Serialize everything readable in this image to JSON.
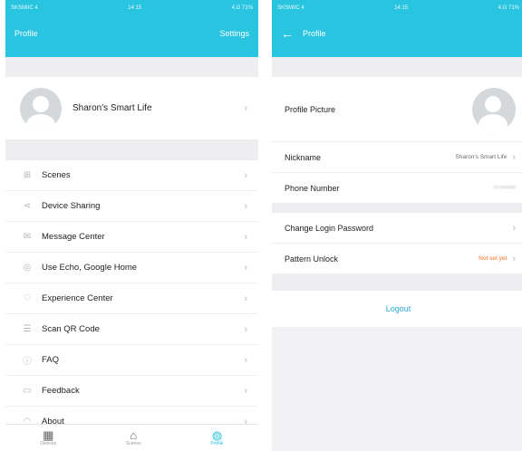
{
  "left": {
    "status": {
      "carrier": "SKSMIIC 4",
      "time": "14:15",
      "right": "4.G 71%"
    },
    "header": {
      "title": "Profile",
      "settings": "Settings"
    },
    "profile_name": "Sharon's Smart Life",
    "menu": [
      {
        "icon": "scenes-icon",
        "glyph": "⊞",
        "label": "Scenes"
      },
      {
        "icon": "share-icon",
        "glyph": "⋖",
        "label": "Device Sharing"
      },
      {
        "icon": "message-icon",
        "glyph": "✉",
        "label": "Message Center"
      },
      {
        "icon": "echo-icon",
        "glyph": "◎",
        "label": "Use Echo, Google Home"
      },
      {
        "icon": "heart-icon",
        "glyph": "♡",
        "label": "Experience Center"
      },
      {
        "icon": "qr-icon",
        "glyph": "☰",
        "label": "Scan QR Code"
      },
      {
        "icon": "faq-icon",
        "glyph": "ⓘ",
        "label": "FAQ"
      },
      {
        "icon": "feedback-icon",
        "glyph": "▭",
        "label": "Feedback"
      },
      {
        "icon": "about-icon",
        "glyph": "◠",
        "label": "About"
      }
    ],
    "tabs": [
      {
        "icon": "devices-icon",
        "glyph": "▦",
        "label": "Devices"
      },
      {
        "icon": "home-icon",
        "glyph": "⌂",
        "label": "Scenes"
      },
      {
        "icon": "profile-icon",
        "glyph": "◍",
        "label": "Profile"
      }
    ]
  },
  "right": {
    "status": {
      "carrier": "SKSMIIC 4",
      "time": "14:15",
      "right": "4.G 71%"
    },
    "header": {
      "title": "Profile"
    },
    "rows": {
      "profile_picture": "Profile Picture",
      "nickname_label": "Nickname",
      "nickname_value": "Sharon's Smart Life",
      "phone_label": "Phone Number",
      "phone_value": "••• ••••••••••",
      "change_password": "Change Login Password",
      "pattern_label": "Pattern Unlock",
      "pattern_value": "Not set yet"
    },
    "logout": "Logout"
  },
  "colors": {
    "accent": "#29c4e0",
    "warning": "#ff6a1a",
    "link": "#29a7d8"
  }
}
